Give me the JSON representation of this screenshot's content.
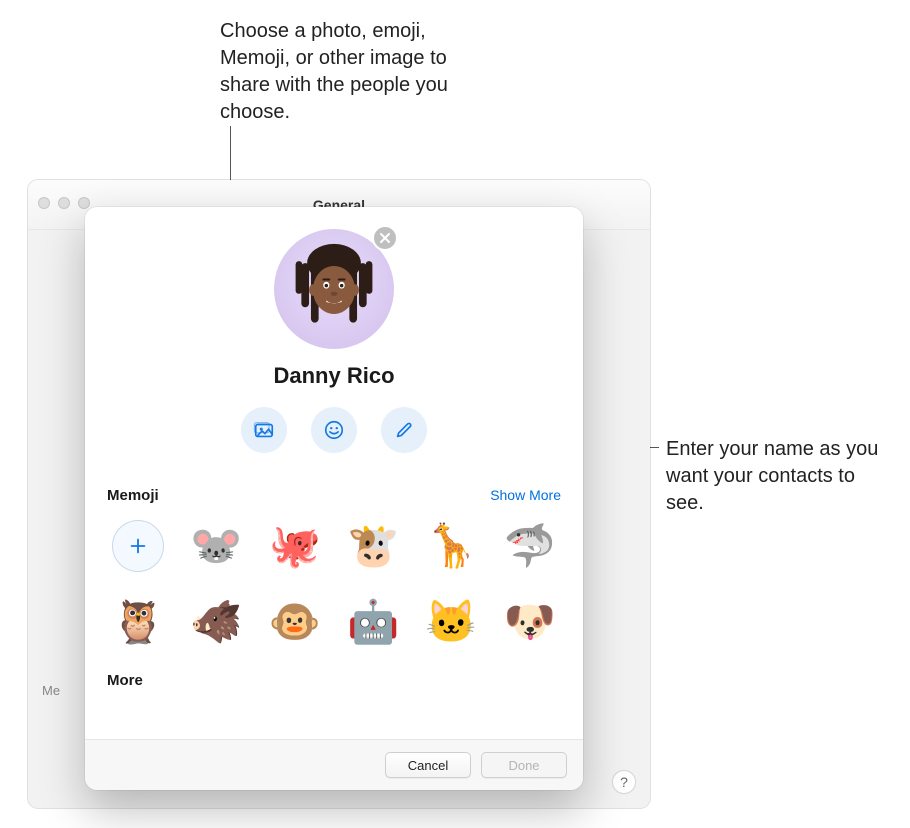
{
  "callouts": {
    "top": "Choose a photo, emoji, Memoji, or other image to share with the people you choose.",
    "right": "Enter your name as you want your contacts to see."
  },
  "outer_window": {
    "title": "General",
    "help_label": "?",
    "bg_left_text": "Me"
  },
  "dialog": {
    "display_name": "Danny Rico",
    "memoji_section_title": "Memoji",
    "show_more_label": "Show More",
    "more_section_title": "More",
    "footer": {
      "cancel_label": "Cancel",
      "done_label": "Done"
    },
    "memoji": [
      {
        "name": "add-memoji",
        "glyph": ""
      },
      {
        "name": "mouse-memoji",
        "glyph": "🐭"
      },
      {
        "name": "octopus-memoji",
        "glyph": "🐙"
      },
      {
        "name": "cow-memoji",
        "glyph": "🐮"
      },
      {
        "name": "giraffe-memoji",
        "glyph": "🦒"
      },
      {
        "name": "shark-memoji",
        "glyph": "🦈"
      },
      {
        "name": "owl-memoji",
        "glyph": "🦉"
      },
      {
        "name": "boar-memoji",
        "glyph": "🐗"
      },
      {
        "name": "monkey-memoji",
        "glyph": "🐵"
      },
      {
        "name": "robot-memoji",
        "glyph": "🤖"
      },
      {
        "name": "cat-memoji",
        "glyph": "🐱"
      },
      {
        "name": "dog-memoji",
        "glyph": "🐶"
      }
    ]
  }
}
